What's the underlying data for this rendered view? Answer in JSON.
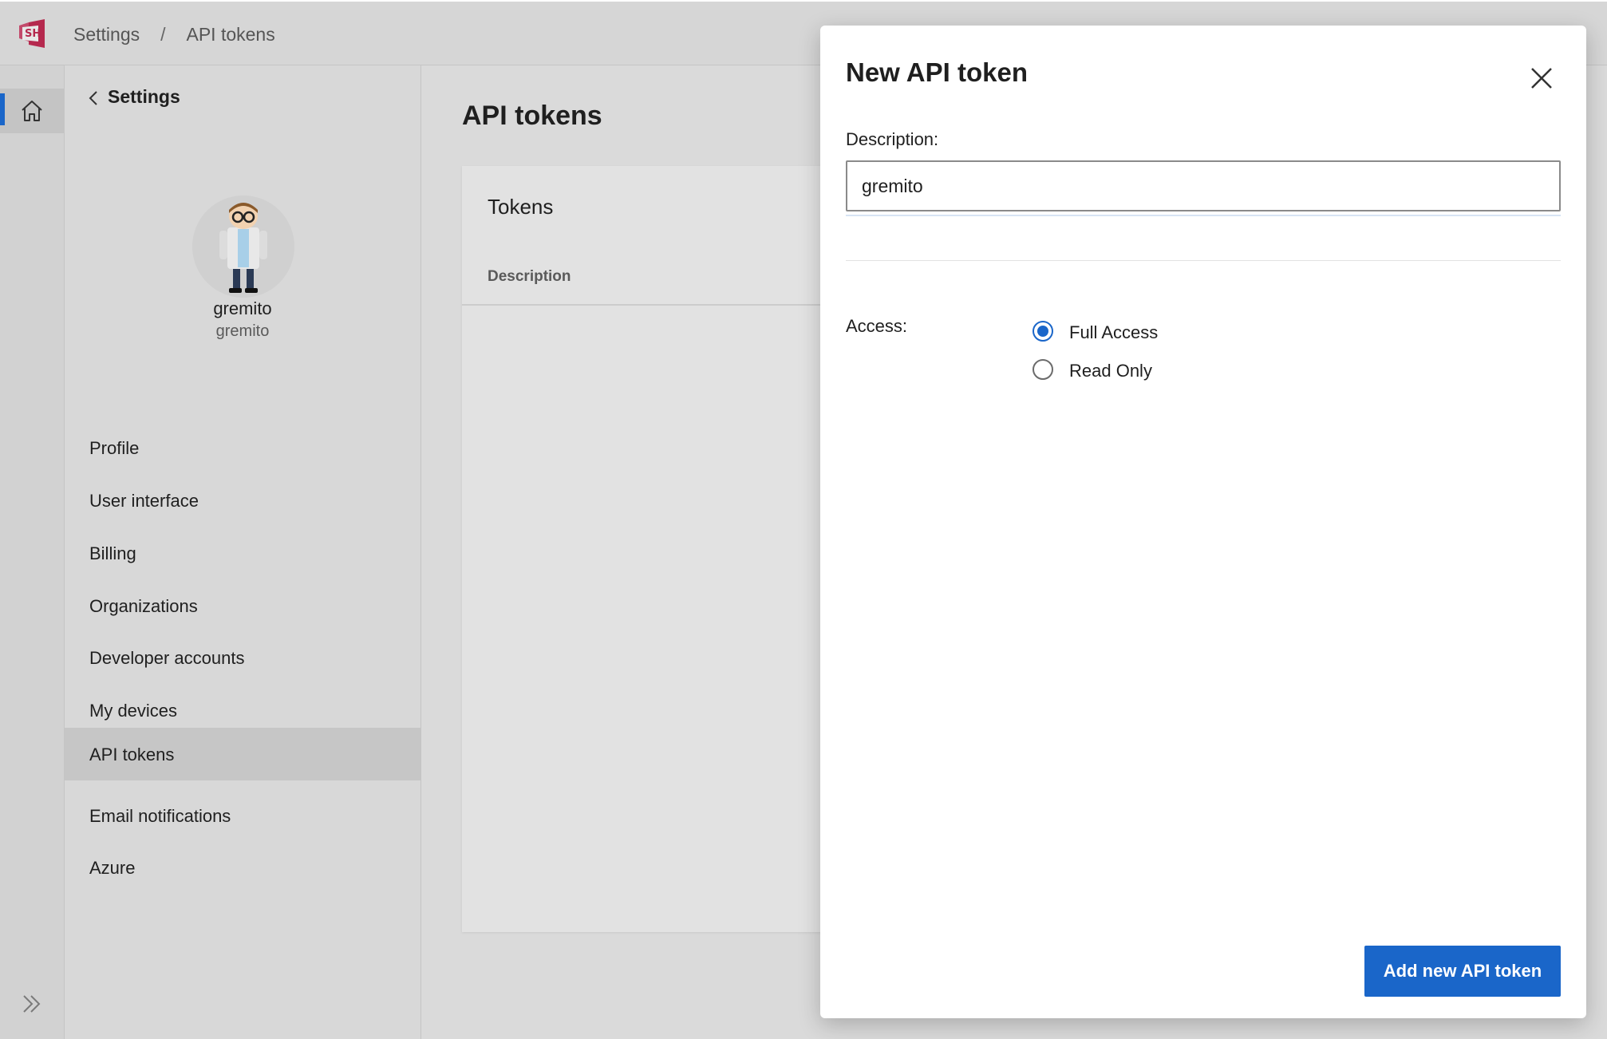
{
  "header": {
    "breadcrumb": [
      "Settings",
      "API tokens"
    ]
  },
  "sidenav": {
    "back_label": "Settings",
    "user_name": "gremito",
    "user_handle": "gremito",
    "items": [
      {
        "label": "Profile",
        "active": false
      },
      {
        "label": "User interface",
        "active": false
      },
      {
        "label": "Billing",
        "active": false
      },
      {
        "label": "Organizations",
        "active": false
      },
      {
        "label": "Developer accounts",
        "active": false
      },
      {
        "label": "My devices",
        "active": false
      },
      {
        "label": "API tokens",
        "active": true
      },
      {
        "label": "Email notifications",
        "active": false
      },
      {
        "label": "Azure",
        "active": false
      }
    ]
  },
  "main": {
    "title": "API tokens",
    "tokens_card": {
      "heading": "Tokens",
      "columns": [
        "Description"
      ]
    }
  },
  "modal": {
    "title": "New API token",
    "description_label": "Description:",
    "description_value": "gremito",
    "access_label": "Access:",
    "access_options": [
      {
        "label": "Full Access",
        "checked": true
      },
      {
        "label": "Read Only",
        "checked": false
      }
    ],
    "submit_label": "Add new API token"
  },
  "colors": {
    "accent": "#1a66c9",
    "logo": "#b5294e"
  },
  "icons": {
    "logo": "app-logo-icon",
    "home": "home-icon",
    "back": "chevron-left-icon",
    "close": "close-icon",
    "expand": "double-chevron-right-icon"
  }
}
